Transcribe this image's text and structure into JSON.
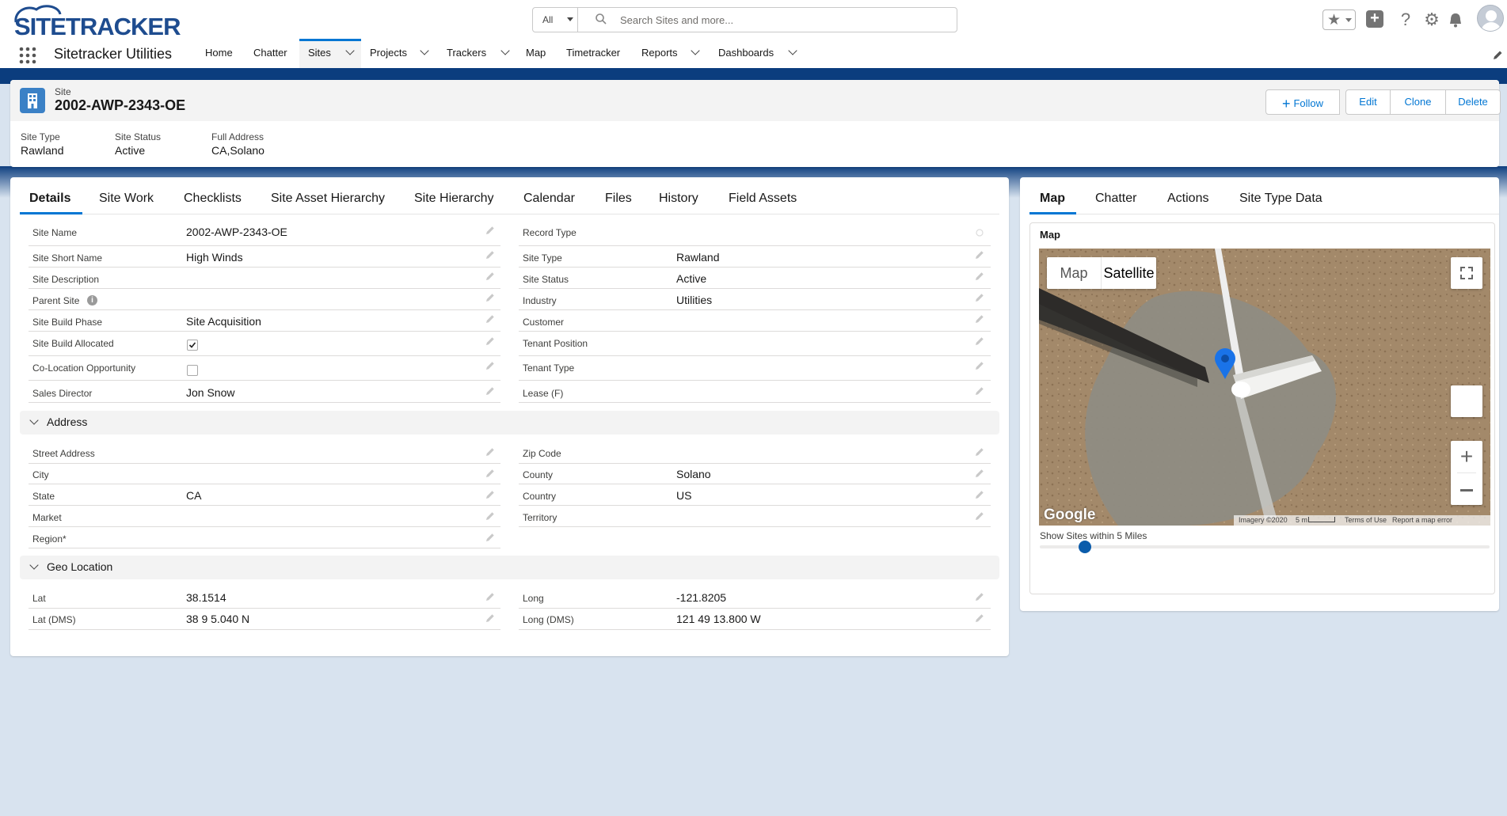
{
  "brand": {
    "logo_text": "SITETRACKER",
    "app_name": "Sitetracker Utilities"
  },
  "search": {
    "scope": "All",
    "placeholder": "Search Sites and more..."
  },
  "nav": {
    "items": [
      {
        "label": "Home"
      },
      {
        "label": "Chatter"
      },
      {
        "label": "Sites"
      },
      {
        "label": "Projects"
      },
      {
        "label": "Trackers"
      },
      {
        "label": "Map"
      },
      {
        "label": "Timetracker"
      },
      {
        "label": "Reports"
      },
      {
        "label": "Dashboards"
      }
    ]
  },
  "record": {
    "object": "Site",
    "name": "2002-AWP-2343-OE"
  },
  "actions": {
    "follow": "Follow",
    "edit": "Edit",
    "clone": "Clone",
    "delete": "Delete"
  },
  "highlights": [
    {
      "label": "Site Type",
      "value": "Rawland"
    },
    {
      "label": "Site Status",
      "value": "Active"
    },
    {
      "label": "Full Address",
      "value": "CA,Solano"
    }
  ],
  "tabs": [
    "Details",
    "Site Work",
    "Checklists",
    "Site Asset Hierarchy",
    "Site Hierarchy",
    "Calendar",
    "Files",
    "History",
    "Field Assets"
  ],
  "details": {
    "left": [
      {
        "label": "Site Name",
        "value": "2002-AWP-2343-OE"
      },
      {
        "label": "Site Short Name",
        "value": "High Winds"
      },
      {
        "label": "Site Description",
        "value": ""
      },
      {
        "label": "Parent Site",
        "value": ""
      },
      {
        "label": "Site Build Phase",
        "value": "Site Acquisition"
      },
      {
        "label": "Site Build Allocated",
        "checked": true
      },
      {
        "label": "Co-Location Opportunity",
        "checked": false
      },
      {
        "label": "Sales Director",
        "value": "Jon Snow"
      }
    ],
    "right": [
      {
        "label": "Record Type",
        "value": ""
      },
      {
        "label": "Site Type",
        "value": "Rawland"
      },
      {
        "label": "Site Status",
        "value": "Active"
      },
      {
        "label": "Industry",
        "value": "Utilities"
      },
      {
        "label": "Customer",
        "value": ""
      },
      {
        "label": "Tenant Position",
        "value": ""
      },
      {
        "label": "Tenant Type",
        "value": ""
      },
      {
        "label": "Lease (F)",
        "value": ""
      }
    ]
  },
  "address": {
    "title": "Address",
    "left": [
      {
        "label": "Street Address",
        "value": ""
      },
      {
        "label": "City",
        "value": ""
      },
      {
        "label": "State",
        "value": "CA"
      },
      {
        "label": "Market",
        "value": ""
      },
      {
        "label": "Region*",
        "value": ""
      }
    ],
    "right": [
      {
        "label": "Zip Code",
        "value": ""
      },
      {
        "label": "County",
        "value": "Solano"
      },
      {
        "label": "Country",
        "value": "US"
      },
      {
        "label": "Territory",
        "value": ""
      }
    ]
  },
  "geo": {
    "title": "Geo Location",
    "left": [
      {
        "label": "Lat",
        "value": "38.1514"
      },
      {
        "label": "Lat (DMS)",
        "value": "38 9 5.040 N"
      }
    ],
    "right": [
      {
        "label": "Long",
        "value": "-121.8205"
      },
      {
        "label": "Long (DMS)",
        "value": "121 49 13.800 W"
      }
    ]
  },
  "sidetabs": [
    "Map",
    "Chatter",
    "Actions",
    "Site Type Data"
  ],
  "map": {
    "title": "Map",
    "mode_map": "Map",
    "mode_satellite": "Satellite",
    "google": "Google",
    "imagery": "Imagery ©2020",
    "scale": "5 m",
    "terms": "Terms of Use",
    "report": "Report a map error",
    "radius_label": "Show Sites within 5 Miles",
    "radius_fraction": 0.1
  },
  "colors": {
    "brand_blue": "#0176d3",
    "header_blue": "#0b3d7e",
    "page_bg": "#d8e3ef"
  }
}
